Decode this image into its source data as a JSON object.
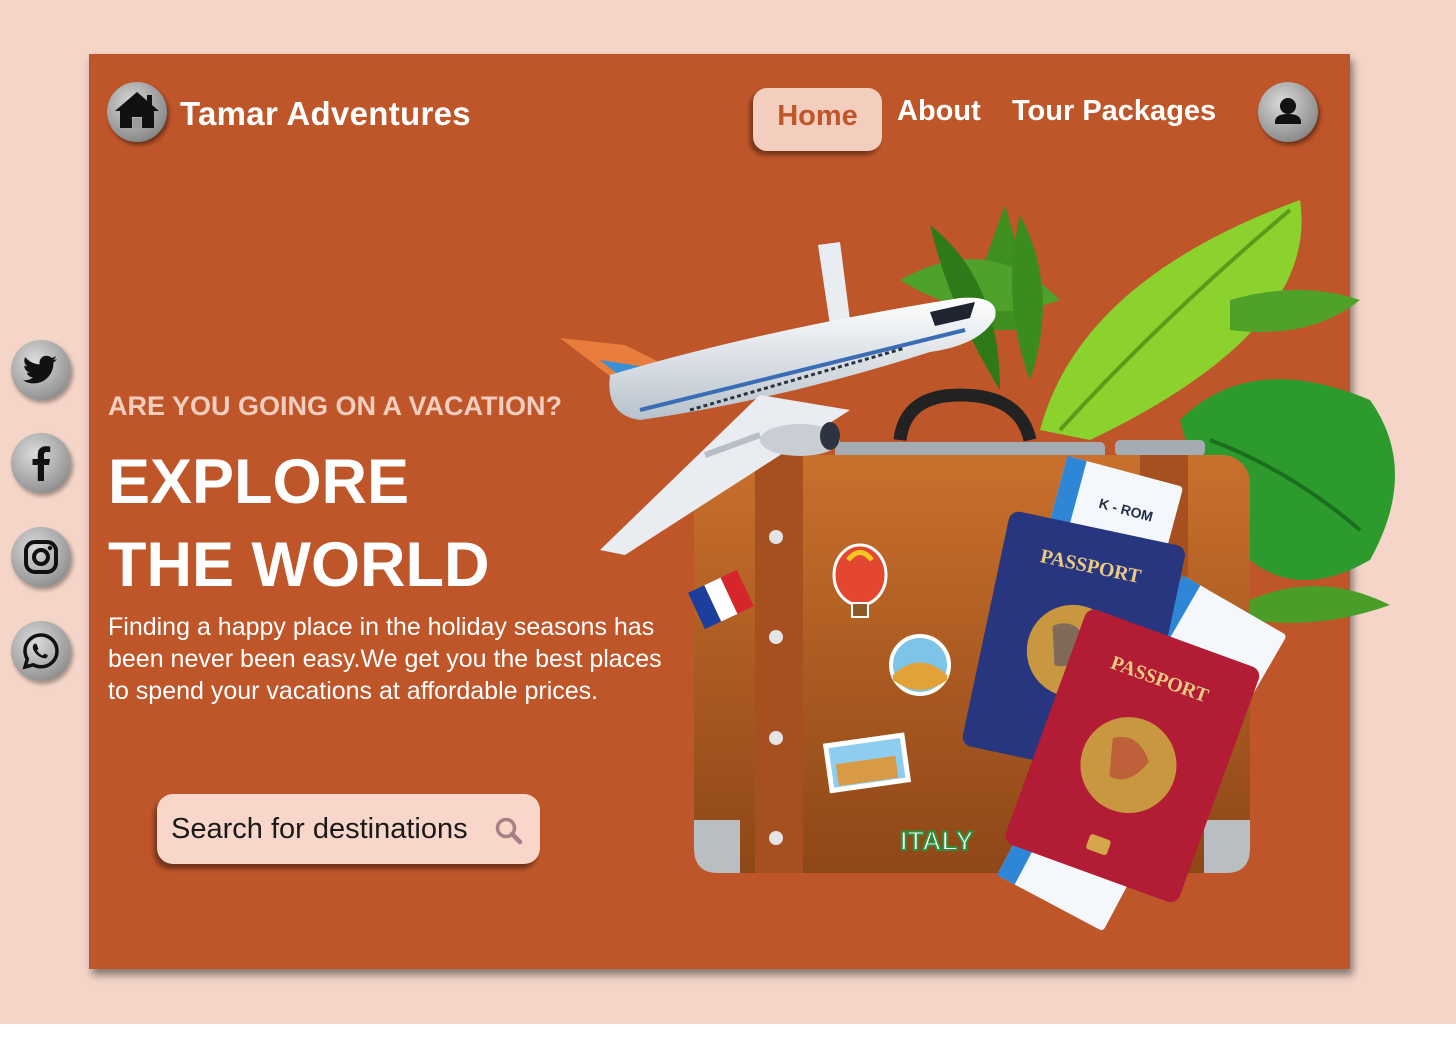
{
  "brand": {
    "name": "Tamar Adventures",
    "logo_icon": "home-icon"
  },
  "nav": {
    "items": [
      {
        "label": "Home",
        "active": true
      },
      {
        "label": "About",
        "active": false
      },
      {
        "label": "Tour Packages",
        "active": false
      }
    ],
    "profile_icon": "user-icon"
  },
  "social": [
    {
      "icon": "twitter-icon"
    },
    {
      "icon": "facebook-icon"
    },
    {
      "icon": "instagram-icon"
    },
    {
      "icon": "whatsapp-icon"
    }
  ],
  "hero": {
    "eyebrow": "ARE YOU GOING ON A VACATION?",
    "headline_line1": "EXPLORE",
    "headline_line2": "THE WORLD",
    "description": "Finding a happy place in the holiday seasons has been never been easy.We get you the best places to spend your vacations at affordable prices."
  },
  "search": {
    "placeholder": "Search for destinations",
    "value": ""
  },
  "illustration": {
    "passport_label": "PASSPORT",
    "sticker_text": "ITALY",
    "ticket_text": "K - ROM"
  },
  "colors": {
    "page_background": "#f5d5c8",
    "card_background": "#bf562a",
    "accent_light": "#f3cdbd",
    "text_light": "#ffffff"
  }
}
